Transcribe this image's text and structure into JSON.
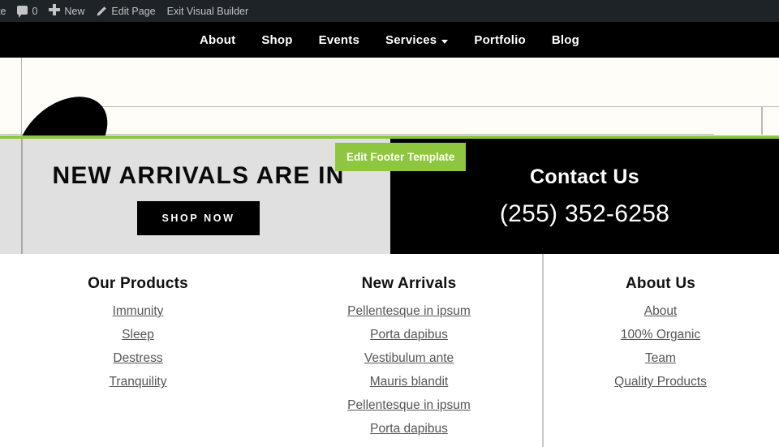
{
  "admin_bar": {
    "site_label": "te",
    "comment_icon": "comment-bubble-icon",
    "comment_count": "0",
    "new_icon": "plus-icon",
    "new_label": "New",
    "edit_icon": "pencil-icon",
    "edit_page_label": "Edit Page",
    "exit_builder_label": "Exit Visual Builder",
    "background_color": "#1d2327",
    "text_color": "#c3c4c7"
  },
  "site_nav": {
    "background_color": "#000000",
    "items": [
      {
        "label": "About",
        "has_caret": false
      },
      {
        "label": "Shop",
        "has_caret": false
      },
      {
        "label": "Events",
        "has_caret": false
      },
      {
        "label": "Services",
        "has_caret": true
      },
      {
        "label": "Portfolio",
        "has_caret": false
      },
      {
        "label": "Blog",
        "has_caret": false
      }
    ]
  },
  "page_body": {
    "background_color": "#fffdf8",
    "shape": "black-ellipse"
  },
  "footer": {
    "top_border_color": "#8ec63f",
    "edit_template_button": {
      "label": "Edit Footer Template",
      "color": "#8ec63f"
    },
    "promo": {
      "heading": "NEW ARRIVALS ARE IN",
      "button_label": "SHOP NOW",
      "background_color": "#e0e0e0"
    },
    "contact": {
      "heading": "Contact Us",
      "phone": "(255) 352-6258",
      "background_color": "#000000"
    },
    "columns": [
      {
        "title": "Our Products",
        "links": [
          "Immunity",
          "Sleep",
          "Destress",
          "Tranquility"
        ]
      },
      {
        "title": "New Arrivals",
        "links": [
          "Pellentesque in ipsum",
          "Porta dapibus",
          "Vestibulum ante",
          "Mauris blandit",
          "Pellentesque in ipsum",
          "Porta dapibus"
        ]
      },
      {
        "title": "About Us",
        "links": [
          "About",
          "100% Organic",
          "Team",
          "Quality Products"
        ]
      }
    ]
  }
}
